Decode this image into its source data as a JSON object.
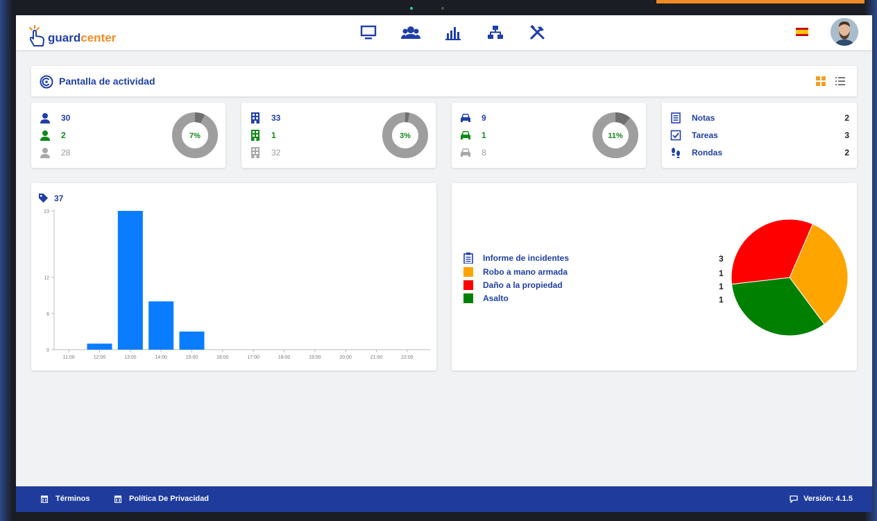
{
  "app": {
    "logo_part1": "guard",
    "logo_part2": "center",
    "nav_icons": [
      "monitor-icon",
      "users-icon",
      "bar-chart-icon",
      "sitemap-icon",
      "tools-icon"
    ],
    "language_flag": "es-flag",
    "colors": {
      "primary": "#1f3fa6",
      "accent": "#f08a24",
      "green": "#0e8a16",
      "gray": "#9e9e9e",
      "footer": "#1f3c9d"
    }
  },
  "title": {
    "label": "Pantalla de actividad"
  },
  "stats": {
    "users": {
      "total": "30",
      "active": "2",
      "inactive": "28",
      "percent": "7%",
      "fraction": 0.07
    },
    "buildings": {
      "total": "33",
      "active": "1",
      "inactive": "32",
      "percent": "3%",
      "fraction": 0.03
    },
    "vehicles": {
      "total": "9",
      "active": "1",
      "inactive": "8",
      "percent": "11%",
      "fraction": 0.11
    },
    "tasks": [
      {
        "label": "Notas",
        "value": "2",
        "icon": "notes-icon"
      },
      {
        "label": "Tareas",
        "value": "3",
        "icon": "checkbox-icon"
      },
      {
        "label": "Rondas",
        "value": "2",
        "icon": "footsteps-icon"
      }
    ]
  },
  "bar_panel": {
    "tag_count": "37"
  },
  "incidents": {
    "header_label": "Informe de incidentes",
    "header_value": "3",
    "items": [
      {
        "label": "Robo a mano armada",
        "value": "1",
        "color": "#ffa500"
      },
      {
        "label": "Daño a la propiedad",
        "value": "1",
        "color": "#ff0000"
      },
      {
        "label": "Asalto",
        "value": "1",
        "color": "#008000"
      }
    ]
  },
  "chart_data": [
    {
      "type": "bar",
      "categories": [
        "11:00",
        "12:00",
        "13:00",
        "14:00",
        "15:00",
        "16:00",
        "17:00",
        "18:00",
        "19:00",
        "20:00",
        "21:00",
        "22:00"
      ],
      "values": [
        0,
        1,
        23,
        8,
        3,
        0,
        0,
        0,
        0,
        0,
        0,
        0
      ],
      "yticks": [
        "0",
        "6",
        "12",
        "23"
      ],
      "ylim": [
        0,
        23
      ],
      "color": "#0a7cff"
    },
    {
      "type": "pie",
      "labels": [
        "Robo a mano armada",
        "Daño a la propiedad",
        "Asalto"
      ],
      "values": [
        1,
        1,
        1
      ],
      "colors": [
        "#ffa500",
        "#ff0000",
        "#008000"
      ]
    }
  ],
  "footer": {
    "terms": "Términos",
    "privacy": "Política De Privacidad",
    "version": "Versión: 4.1.5"
  }
}
